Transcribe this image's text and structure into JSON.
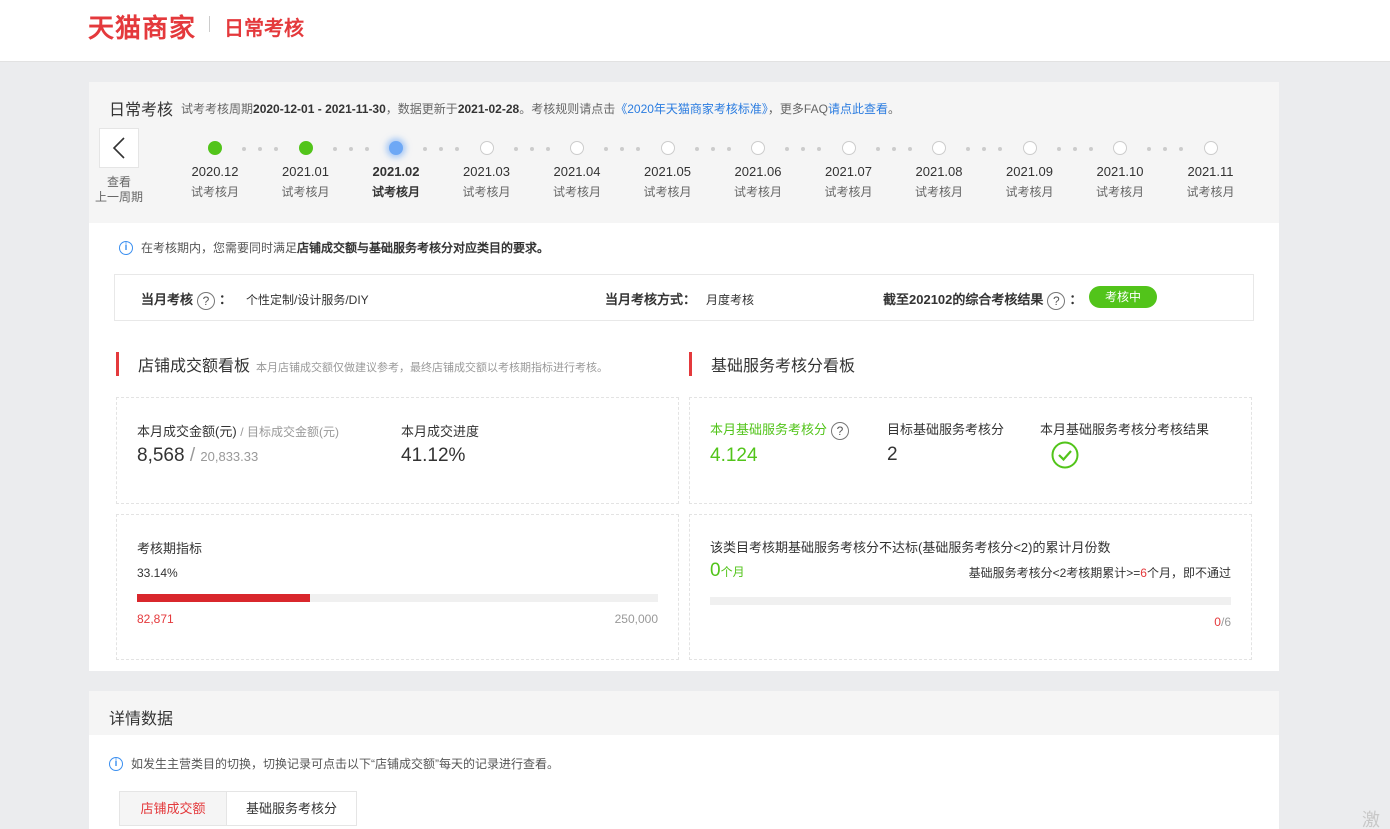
{
  "brand": {
    "logo": "天猫商家",
    "section": "日常考核"
  },
  "header": {
    "title": "日常考核",
    "cycle_prefix": "试考考核周期",
    "cycle_range": "2020-12-01 - 2021-11-30",
    "update_prefix": "，数据更新于",
    "update_date": "2021-02-28",
    "rule_text": "。考核规则请点击",
    "rule_link": "《2020年天猫商家考核标准》",
    "faq_text": "，更多FAQ",
    "faq_link": "请点此查看",
    "end": "。"
  },
  "prev_cycle": {
    "line1": "查看",
    "line2": "上一周期"
  },
  "timeline": [
    {
      "month": "2020.12",
      "type": "试考核月",
      "status": "done"
    },
    {
      "month": "2021.01",
      "type": "试考核月",
      "status": "done"
    },
    {
      "month": "2021.02",
      "type": "试考核月",
      "status": "current"
    },
    {
      "month": "2021.03",
      "type": "试考核月",
      "status": "pending"
    },
    {
      "month": "2021.04",
      "type": "试考核月",
      "status": "pending"
    },
    {
      "month": "2021.05",
      "type": "试考核月",
      "status": "pending"
    },
    {
      "month": "2021.06",
      "type": "试考核月",
      "status": "pending"
    },
    {
      "month": "2021.07",
      "type": "试考核月",
      "status": "pending"
    },
    {
      "month": "2021.08",
      "type": "试考核月",
      "status": "pending"
    },
    {
      "month": "2021.09",
      "type": "试考核月",
      "status": "pending"
    },
    {
      "month": "2021.10",
      "type": "试考核月",
      "status": "pending"
    },
    {
      "month": "2021.11",
      "type": "试考核月",
      "status": "pending"
    }
  ],
  "notice1": {
    "prefix": "在考核期内，您需要同时满足",
    "bold": "店铺成交额与基础服务考核分对应类目的要求。"
  },
  "summary": {
    "month_label": "当月考核",
    "colon": "：",
    "category": "个性定制/设计服务/DIY",
    "method_label": "当月考核方式：",
    "method": "月度考核",
    "result_label": "截至202102的综合考核结果",
    "status": "考核中"
  },
  "sales_board": {
    "title": "店铺成交额看板",
    "note": "本月店铺成交额仅做建议参考，最终店铺成交额以考核期指标进行考核。",
    "amount_label": "本月成交金额(元)",
    "target_label": "/ 目标成交金额(元)",
    "amount": "8,568",
    "slash": "/",
    "target": "20,833.33",
    "progress_label": "本月成交进度",
    "progress": "41.12%",
    "period_label": "考核期指标",
    "period_percent": "33.14%",
    "period_fraction": 0.3314,
    "period_value": "82,871",
    "period_target": "250,000"
  },
  "service_board": {
    "title": "基础服务考核分看板",
    "score_label": "本月基础服务考核分",
    "score": "4.124",
    "target_label": "目标基础服务考核分",
    "target": "2",
    "result_label": "本月基础服务考核分考核结果",
    "fail_desc": "该类目考核期基础服务考核分不达标(基础服务考核分<2)的累计月份数",
    "fail_count": "0",
    "fail_unit": "个月",
    "rule_prefix": "基础服务考核分<2考核期累计>=",
    "rule_num": "6",
    "rule_suffix": "个月，即不通过",
    "ratio_cur": "0",
    "ratio_total": "/6",
    "ratio_fraction": 0
  },
  "details": {
    "title": "详情数据",
    "notice": "如发生主营类目的切换，切换记录可点击以下“店铺成交额”每天的记录进行查看。",
    "tabs": [
      "店铺成交额",
      "基础服务考核分"
    ]
  },
  "watermark": "激活",
  "colors": {
    "brand_red": "#e4393c",
    "success_green": "#52c41a",
    "link_blue": "#2a7ce0",
    "current_blue": "#6ea8f5"
  }
}
